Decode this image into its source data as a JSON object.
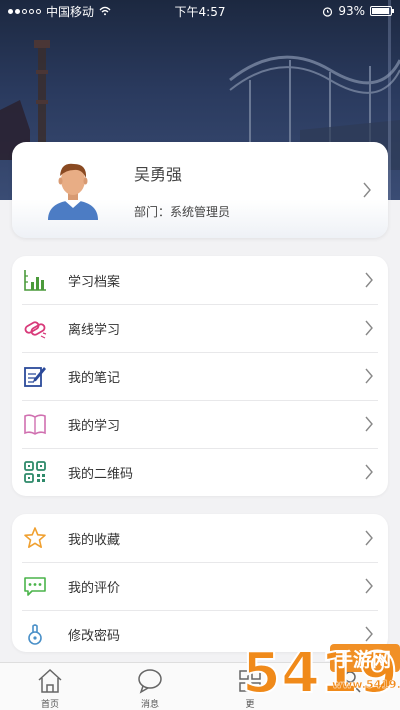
{
  "status_bar": {
    "carrier": "中国移动",
    "time": "下午4:57",
    "battery": "93%",
    "battery_level": 0.93
  },
  "profile": {
    "name": "吴勇强",
    "dept_label": "部门：",
    "dept_value": "系统管理员"
  },
  "menu_group_1": [
    {
      "label": "学习档案",
      "icon": "bar-chart-icon"
    },
    {
      "label": "离线学习",
      "icon": "offline-link-icon"
    },
    {
      "label": "我的笔记",
      "icon": "notebook-pen-icon"
    },
    {
      "label": "我的学习",
      "icon": "open-book-icon"
    },
    {
      "label": "我的二维码",
      "icon": "qr-code-icon"
    }
  ],
  "menu_group_2": [
    {
      "label": "我的收藏",
      "icon": "star-icon"
    },
    {
      "label": "我的评价",
      "icon": "comment-icon"
    },
    {
      "label": "修改密码",
      "icon": "key-lock-icon"
    }
  ],
  "tab_bar": [
    {
      "label": "首页",
      "icon": "home-icon"
    },
    {
      "label": "消息",
      "icon": "chat-bubble-icon"
    },
    {
      "label": "更",
      "icon": "grid-icon"
    },
    {
      "label": "",
      "icon": "profile-icon"
    }
  ],
  "watermark": {
    "text_digits": "5419",
    "text_cn": "手游网",
    "url": "www.5419.cn"
  },
  "colors": {
    "accent_green": "#4a9a3a",
    "accent_pink": "#d83a7a",
    "accent_blue": "#2b4a9a",
    "accent_orange": "#f0a030",
    "watermark_orange": "#f08a1a"
  }
}
